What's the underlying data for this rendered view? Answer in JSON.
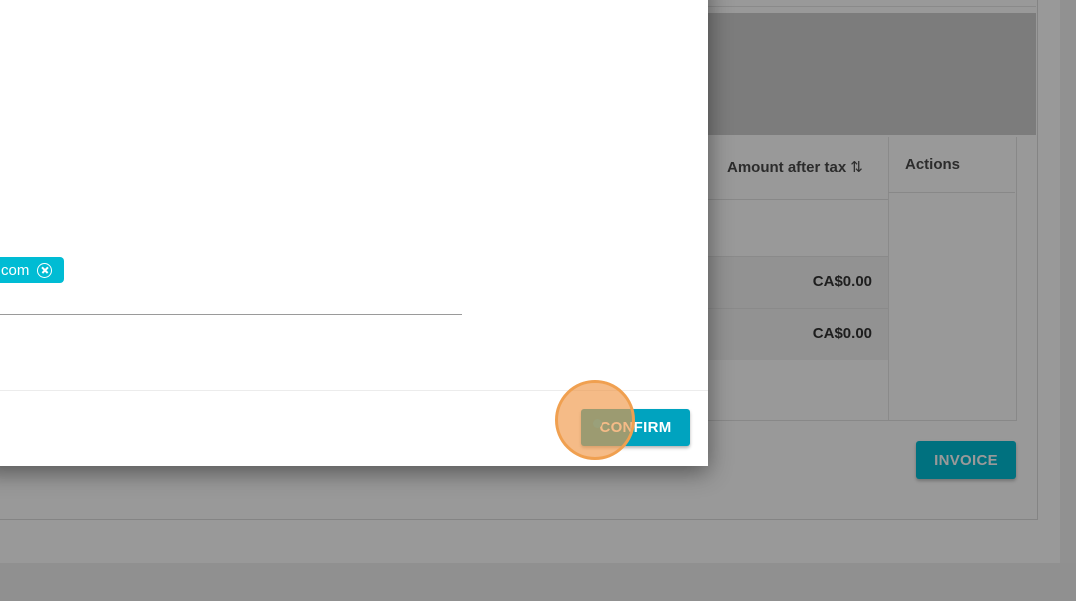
{
  "background": {
    "table": {
      "headers": {
        "amount_after_tax": "Amount after tax",
        "actions": "Actions"
      },
      "rows": [
        {
          "amount": "CA$0.00"
        },
        {
          "amount": "CA$0.00"
        }
      ]
    },
    "invoice_button_label": "INVOICE"
  },
  "modal": {
    "email_chip_text": "com",
    "confirm_button_label": "CONFIRM"
  },
  "icons": {
    "sort": "sort-icon",
    "chip_remove": "close-circle-icon"
  },
  "colors": {
    "accent": "#00bcd4",
    "click_highlight": "#f0a050"
  }
}
